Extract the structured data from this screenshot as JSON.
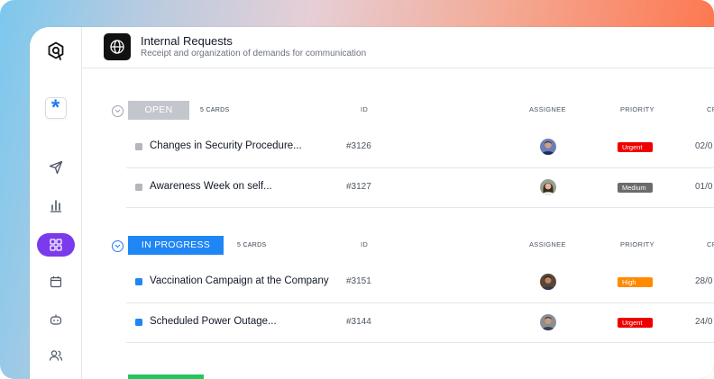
{
  "header": {
    "title": "Internal Requests",
    "subtitle": "Receipt and organization of demands for communication"
  },
  "sidebar": {
    "items": [
      {
        "icon": "app-logo-icon"
      },
      {
        "icon": "asterisk-icon"
      },
      {
        "icon": "send-icon"
      },
      {
        "icon": "bar-chart-icon"
      },
      {
        "icon": "grid-icon",
        "active": true
      },
      {
        "icon": "calendar-icon"
      },
      {
        "icon": "bot-icon"
      },
      {
        "icon": "users-icon"
      }
    ]
  },
  "columns": {
    "id": "ID",
    "assignee": "ASSIGNEE",
    "priority": "PRIORITY",
    "created": "CR"
  },
  "groups": [
    {
      "label": "OPEN",
      "count": "5 CARDS",
      "color": "#c3c6cc",
      "rows": [
        {
          "title": "Changes in Security Procedure...",
          "id": "#3126",
          "priority": "Urgent",
          "priority_color": "#ef0000",
          "date": "02/0"
        },
        {
          "title": "Awareness Week on self...",
          "id": "#3127",
          "priority": "Medium",
          "priority_color": "#6b6b6b",
          "date": "01/0"
        }
      ]
    },
    {
      "label": "IN PROGRESS",
      "count": "5 CARDS",
      "color": "#1f86f5",
      "rows": [
        {
          "title": "Vaccination Campaign at the Company",
          "id": "#3151",
          "priority": "High",
          "priority_color": "#ff8a00",
          "date": "28/0"
        },
        {
          "title": "Scheduled Power Outage...",
          "id": "#3144",
          "priority": "Urgent",
          "priority_color": "#ef0000",
          "date": "24/0"
        }
      ]
    },
    {
      "label": "",
      "color": "#22c55e"
    }
  ]
}
